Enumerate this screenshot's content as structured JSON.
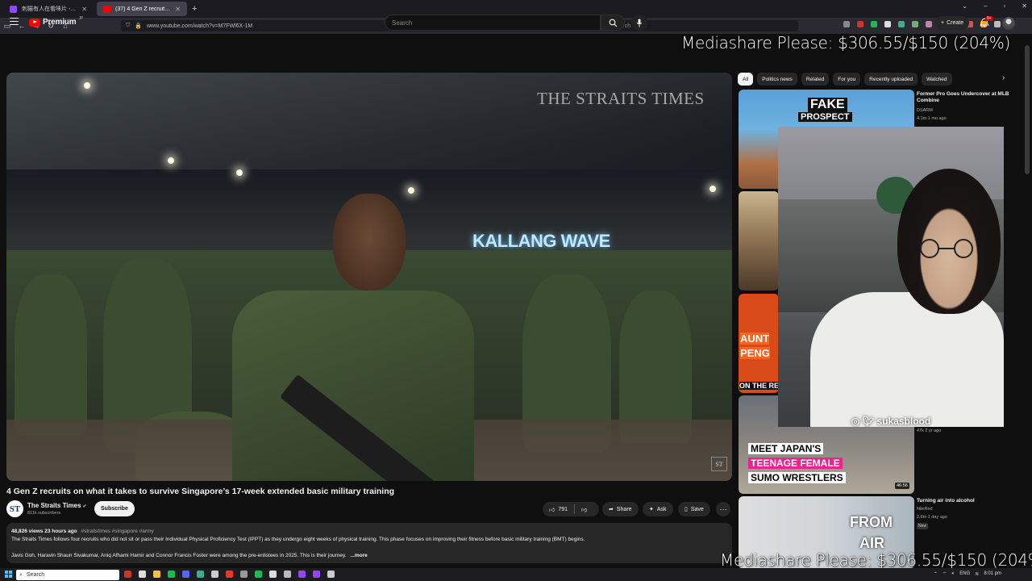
{
  "browser": {
    "tabs": [
      {
        "label": "刺猫有人在看咪片 - Twitch",
        "active": false,
        "icon": "twitch-icon"
      },
      {
        "label": "(37) 4 Gen Z recruits on wh",
        "active": true,
        "icon": "youtube-icon"
      }
    ],
    "new_tab": "+",
    "url": "www.youtube.com/watch?v=M7FWl6X-1M",
    "search_placeholder": "Search"
  },
  "youtube": {
    "logo_text": "Premium",
    "logo_sup": "JP",
    "search_placeholder": "Search",
    "create_label": "Create",
    "notif_badge": "9+"
  },
  "video": {
    "watermark": "THE STRAITS TIMES",
    "venue_sign": "KALLANG WAVE",
    "corner_logo": "ST",
    "title": "4 Gen Z recruits on what it takes to survive Singapore’s 17-week extended basic military training"
  },
  "channel": {
    "name": "The Straits Times",
    "subs": "811k subscribers",
    "avatar": "ST",
    "subscribe": "Subscribe"
  },
  "actions": {
    "likes": "791",
    "share": "Share",
    "ask": "Ask",
    "save": "Save",
    "more": "⋯"
  },
  "description": {
    "meta": "48,826 views  23 hours ago",
    "tags": "#straitstimes #singapore #army",
    "line1": "The Straits Times follows four recruits who did not sit or pass their Individual Physical Proficiency Test (IPPT) as they undergo eight weeks of physical training. This phase focuses on improving their fitness before basic military training (BMT) begins.",
    "line2": "Javis Goh, Haravin Shaun Sivakumar, Aniq Afhami Hamir and Connor Francis Foster were among the pre-enlistees in 2025. This is their journey.",
    "more": "...more"
  },
  "chips": [
    "All",
    "Politics news",
    "Related",
    "For you",
    "Recently uploaded",
    "Watched"
  ],
  "recommendations": [
    {
      "title": "Former Pro Goes Undercover at MLB Combine",
      "channel": "DSARM",
      "meta": "4.1m  1 mo ago",
      "thumb_text": [
        "FAKE",
        "PROSPECT"
      ]
    },
    {
      "title": "",
      "channel": "",
      "meta": "",
      "thumb_text": []
    },
    {
      "title": "",
      "channel": "",
      "meta": "",
      "thumb_text": [
        "AUNT",
        "PENG",
        "ON THE RED"
      ]
    },
    {
      "title": "",
      "channel": "",
      "meta": "47k  2 yr ago",
      "thumb_text": [
        "MEET JAPAN'S",
        "TEENAGE FEMALE",
        "SUMO WRESTLERS"
      ],
      "duration": "46:56"
    },
    {
      "title": "Turning air into alcohol",
      "channel": "NileRed",
      "meta": "2.6m  1 day ago",
      "badge": "New",
      "thumb_text": [
        "FROM",
        "AIR"
      ]
    }
  ],
  "webcam": {
    "handle": "sukasblood"
  },
  "overlays": {
    "mediashare": "Mediashare Please: $306.55/$150 (204%)"
  },
  "taskbar": {
    "search": "Search",
    "lang": "ENG",
    "time": "8:01 pm"
  },
  "colors": {
    "yt_red": "#ff0000",
    "bg": "#0f0f0f",
    "pill": "#272727"
  }
}
